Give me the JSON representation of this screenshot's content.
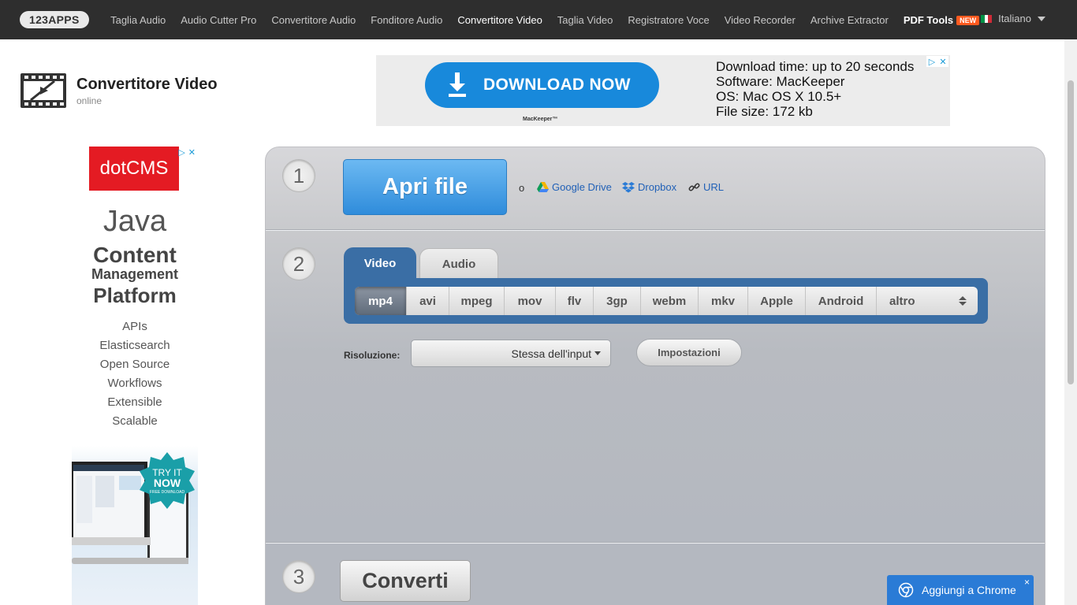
{
  "nav": {
    "logo": "123APPS",
    "links": [
      "Taglia Audio",
      "Audio Cutter Pro",
      "Convertitore Audio",
      "Fonditore Audio",
      "Convertitore Video",
      "Taglia Video",
      "Registratore Voce",
      "Video Recorder",
      "Archive Extractor"
    ],
    "active": "Convertitore Video",
    "pdf_tools": "PDF Tools",
    "new_badge": "NEW",
    "language": "Italiano"
  },
  "app": {
    "title": "Convertitore Video",
    "subtitle": "online"
  },
  "ad_top": {
    "button": "DOWNLOAD NOW",
    "brand": "MacKeeper™",
    "info": [
      "Download time: up to 20 seconds",
      "Software: MacKeeper",
      "OS: Mac OS X 10.5+",
      "File size: 172 kb"
    ]
  },
  "ad_side": {
    "brand": "dotCMS",
    "headline": [
      "Java",
      "Content",
      "Management",
      "Platform"
    ],
    "features": [
      "APIs",
      "Elasticsearch",
      "Open Source",
      "Workflows",
      "Extensible",
      "Scalable"
    ],
    "badge": [
      "TRY IT",
      "NOW",
      "FREE DOWNLOAD"
    ]
  },
  "steps": {
    "step1": {
      "number": "1",
      "open_button": "Apri file",
      "or": "o",
      "sources": [
        "Google Drive",
        "Dropbox",
        "URL"
      ]
    },
    "step2": {
      "number": "2",
      "tabs": [
        "Video",
        "Audio"
      ],
      "formats": [
        "mp4",
        "avi",
        "mpeg",
        "mov",
        "flv",
        "3gp",
        "webm",
        "mkv",
        "Apple",
        "Android",
        "altro"
      ],
      "selected_format": "mp4",
      "resolution_label": "Risoluzione:",
      "resolution_value": "Stessa dell'input",
      "settings_button": "Impostazioni"
    },
    "step3": {
      "number": "3",
      "convert_button": "Converti"
    }
  },
  "chrome_popup": {
    "label": "Aggiungi a Chrome",
    "close": "×"
  },
  "colors": {
    "nav_bg": "#2e2e2e",
    "accent_blue": "#3a6ea5",
    "open_button": "#2f8cdb",
    "new_badge": "#ff5a1f",
    "dotcms_red": "#e41b23"
  }
}
